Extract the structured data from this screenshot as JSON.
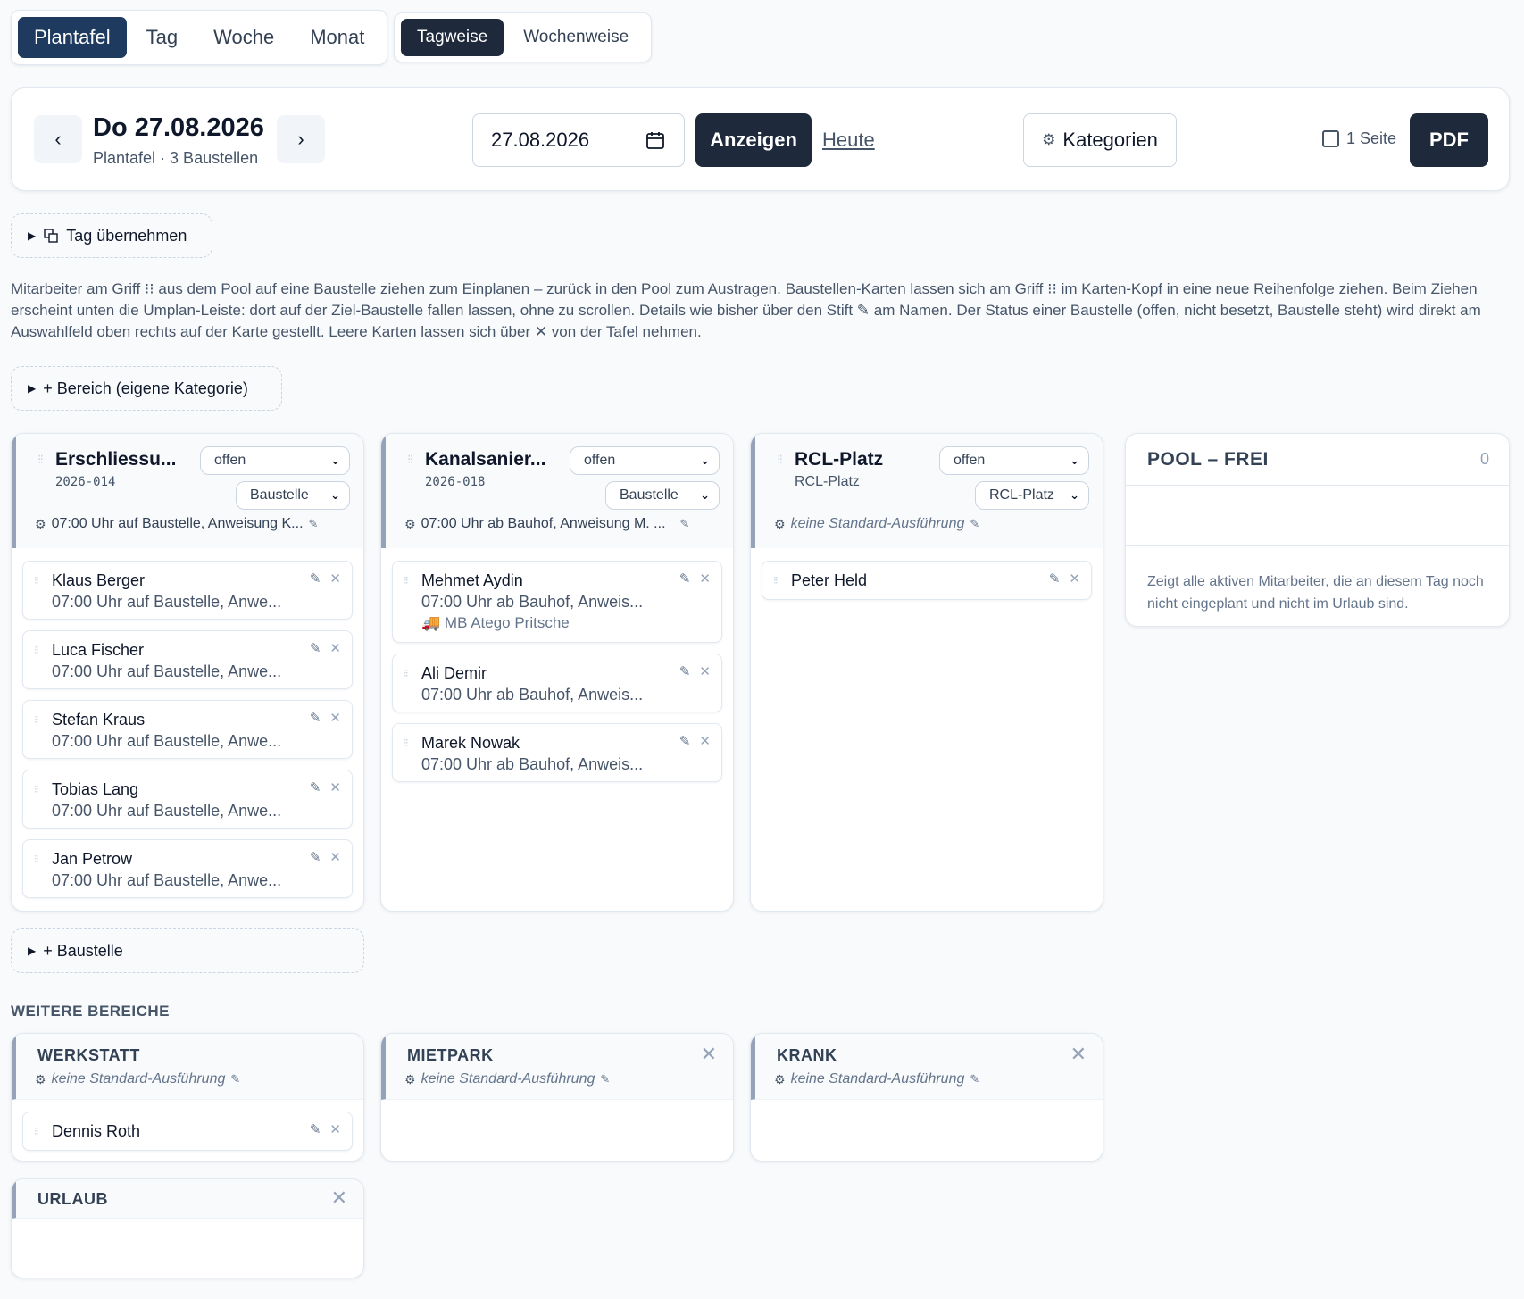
{
  "view_tabs": [
    "Plantafel",
    "Tag",
    "Woche",
    "Monat"
  ],
  "mode_tabs": [
    "Tagweise",
    "Wochenweise"
  ],
  "header": {
    "prev": "‹",
    "next": "›",
    "date_title": "Do 27.08.2026",
    "subtitle": "Plantafel · 3 Baustellen",
    "date_value": "27.08.2026",
    "show_label": "Anzeigen",
    "today_label": "Heute",
    "categories_label": "Kategorien",
    "one_page_label": "1 Seite",
    "pdf_label": "PDF"
  },
  "copy_day_label": "Tag übernehmen",
  "info_text": "Mitarbeiter am Griff ⁝⁝ aus dem Pool auf eine Baustelle ziehen zum Einplanen – zurück in den Pool zum Austragen. Baustellen-Karten lassen sich am Griff ⁝⁝ im Karten-Kopf in eine neue Reihenfolge ziehen. Beim Ziehen erscheint unten die Umplan-Leiste: dort auf der Ziel-Baustelle fallen lassen, ohne zu scrollen. Details wie bisher über den Stift ✎ am Namen. Der Status einer Baustelle (offen, nicht besetzt, Baustelle steht) wird direkt am Auswahlfeld oben rechts auf der Karte gestellt. Leere Karten lassen sich über ✕ von der Tafel nehmen.",
  "add_area_label": "+ Bereich (eigene Kategorie)",
  "add_site_label": "+ Baustelle",
  "sites": [
    {
      "title": "Erschliessu...",
      "code": "2026-014",
      "status": "offen",
      "category": "Baustelle",
      "execution": "07:00 Uhr auf Baustelle, Anweisung K...",
      "employees": [
        {
          "name": "Klaus Berger",
          "detail": "07:00 Uhr auf Baustelle, Anwe..."
        },
        {
          "name": "Luca Fischer",
          "detail": "07:00 Uhr auf Baustelle, Anwe..."
        },
        {
          "name": "Stefan Kraus",
          "detail": "07:00 Uhr auf Baustelle, Anwe..."
        },
        {
          "name": "Tobias Lang",
          "detail": "07:00 Uhr auf Baustelle, Anwe..."
        },
        {
          "name": "Jan Petrow",
          "detail": "07:00 Uhr auf Baustelle, Anwe..."
        }
      ]
    },
    {
      "title": "Kanalsanier...",
      "code": "2026-018",
      "status": "offen",
      "category": "Baustelle",
      "execution": "07:00 Uhr ab Bauhof, Anweisung M. ...",
      "employees": [
        {
          "name": "Mehmet Aydin",
          "detail": "07:00 Uhr ab Bauhof, Anweis...",
          "vehicle": "MB Atego Pritsche"
        },
        {
          "name": "Ali Demir",
          "detail": "07:00 Uhr ab Bauhof, Anweis..."
        },
        {
          "name": "Marek Nowak",
          "detail": "07:00 Uhr ab Bauhof, Anweis..."
        }
      ]
    },
    {
      "title": "RCL-Platz",
      "code": "RCL-Platz",
      "status": "offen",
      "category": "RCL-Platz",
      "execution": "keine Standard-Ausführung",
      "employees": [
        {
          "name": "Peter Held"
        }
      ]
    }
  ],
  "pool": {
    "title": "POOL – FREI",
    "count": "0",
    "hint": "Zeigt alle aktiven Mitarbeiter, die an diesem Tag noch nicht eingeplant und nicht im Urlaub sind."
  },
  "more_areas_label": "WEITERE BEREICHE",
  "areas": [
    {
      "title": "WERKSTATT",
      "execution": "keine Standard-Ausführung",
      "employees": [
        "Dennis Roth"
      ]
    },
    {
      "title": "MIETPARK",
      "execution": "keine Standard-Ausführung",
      "employees": []
    },
    {
      "title": "KRANK",
      "execution": "keine Standard-Ausführung",
      "employees": []
    },
    {
      "title": "URLAUB",
      "employees": []
    }
  ],
  "colors": {
    "primary": "#1e3a5f",
    "dark": "#1e293b",
    "card_accent": "#94a3b8"
  },
  "icons": {
    "drag": "grip-icon",
    "edit": "pencil-icon",
    "remove": "close-icon",
    "time": "gear-icon",
    "calendar": "calendar-icon",
    "vehicle": "truck-icon"
  }
}
